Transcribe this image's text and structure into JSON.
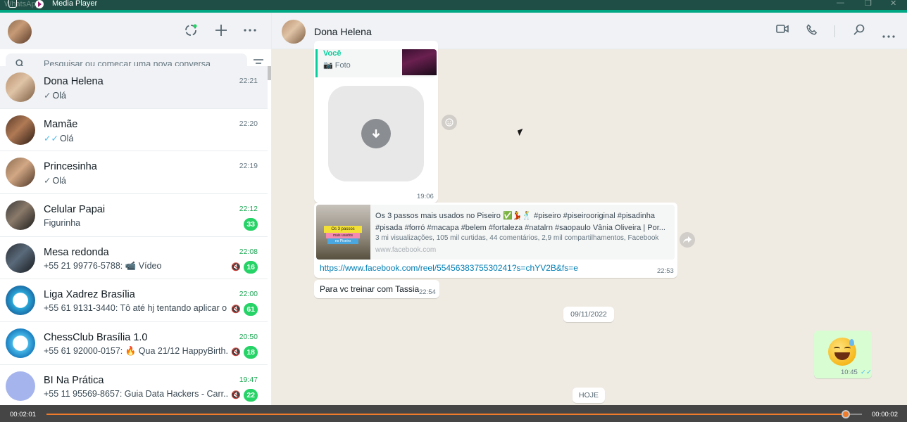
{
  "titlebar": {
    "ghost_label": "WhatsApp",
    "title": "Media Player"
  },
  "colors": {
    "accent": "#00a884",
    "unread_badge": "#25d366",
    "outgoing_bubble": "#d9fdd3",
    "link": "#027eb5",
    "progress": "#f07b2a"
  },
  "left_header": {
    "icons": [
      "status-icon",
      "new-chat-icon",
      "menu-icon"
    ]
  },
  "search": {
    "placeholder": "Pesquisar ou começar uma nova conversa"
  },
  "chats": [
    {
      "name": "Dona Helena",
      "time": "22:21",
      "tick": "✓",
      "preview": "Olá",
      "unread": "",
      "muted": false,
      "active": true
    },
    {
      "name": "Mamãe",
      "time": "22:20",
      "tick": "✓✓",
      "preview": "Olá",
      "unread": "",
      "muted": false,
      "active": false
    },
    {
      "name": "Princesinha",
      "time": "22:19",
      "tick": "✓",
      "preview": "Olá",
      "unread": "",
      "muted": false,
      "active": false
    },
    {
      "name": "Celular Papai",
      "time": "22:12",
      "tick": "",
      "preview": "Figurinha",
      "unread": "33",
      "muted": false,
      "active": false
    },
    {
      "name": "Mesa redonda",
      "time": "22:08",
      "tick": "",
      "preview": "+55 21 99776-5788: 📹 Vídeo",
      "unread": "16",
      "muted": true,
      "active": false
    },
    {
      "name": "Liga Xadrez Brasília",
      "time": "22:00",
      "tick": "",
      "preview": "+55 61 9131-3440: Tô até hj tentando aplicar o ...",
      "unread": "61",
      "muted": true,
      "active": false
    },
    {
      "name": "ChessClub Brasília 1.0",
      "time": "20:50",
      "tick": "",
      "preview": "+55 61 92000-0157: 🔥 Qua 21/12 HappyBirth...",
      "unread": "18",
      "muted": true,
      "active": false
    },
    {
      "name": "BI Na Prática",
      "time": "19:47",
      "tick": "",
      "preview": "+55 11 95569-8657: Guia Data Hackers - Carr...",
      "unread": "22",
      "muted": true,
      "active": false
    }
  ],
  "conversation": {
    "contact_name": "Dona Helena",
    "reply_sender": "Você",
    "reply_type": "Foto",
    "image_time": "19:06",
    "link_title": "Os 3 passos mais usados no Piseiro ✅💃🕺 #piseiro #piseirooriginal #pisadinha #pisada #forró #macapa #belem #fortaleza #natalrn #saopaulo Vânia Oliveira | Por...",
    "link_meta": "3 mi visualizações, 105 mil curtidas, 44 comentários, 2,9 mil compartilhamentos, Facebook",
    "link_domain": "www.facebook.com",
    "link_thumb_tag1": "Os 3 passos",
    "link_thumb_tag2": "mais usados",
    "link_thumb_tag3": "no Piseiro",
    "link_url": "https://www.facebook.com/reel/5545638375530241?s=chYV2B&fs=e",
    "link_time": "22:53",
    "text_msg": "Para vc treinar com Tassia",
    "text_time": "22:54",
    "date_divider": "09/11/2022",
    "emoji_time": "10:45",
    "today_divider": "HOJE"
  },
  "player": {
    "elapsed": "00:02:01",
    "remaining": "00:00:02",
    "progress_fraction": 0.98
  }
}
